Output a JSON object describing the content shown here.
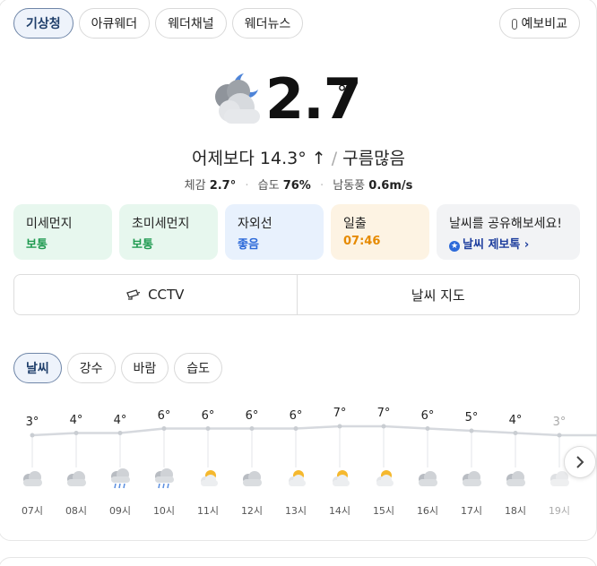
{
  "source_tabs": [
    {
      "label": "기상청",
      "active": true
    },
    {
      "label": "아큐웨더",
      "active": false
    },
    {
      "label": "웨더채널",
      "active": false
    },
    {
      "label": "웨더뉴스",
      "active": false
    }
  ],
  "forecast_compare_label": "예보비교",
  "current": {
    "temp": "2.7",
    "deg": "°",
    "compare": "어제보다 14.3° ↑",
    "condition": "구름많음",
    "feels_label": "체감",
    "feels_value": "2.7°",
    "humidity_label": "습도",
    "humidity_value": "76%",
    "wind_label": "남동풍",
    "wind_value": "0.6m/s"
  },
  "info_cards": [
    {
      "title": "미세먼지",
      "value": "보통"
    },
    {
      "title": "초미세먼지",
      "value": "보통"
    },
    {
      "title": "자외선",
      "value": "좋음"
    },
    {
      "title": "일출",
      "value": "07:46"
    },
    {
      "title": "날씨를 공유해보세요!",
      "value": "날씨 제보톡 ›"
    }
  ],
  "actions": {
    "cctv": "CCTV",
    "map": "날씨 지도"
  },
  "sub_tabs": [
    {
      "label": "날씨",
      "active": true
    },
    {
      "label": "강수",
      "active": false
    },
    {
      "label": "바람",
      "active": false
    },
    {
      "label": "습도",
      "active": false
    }
  ],
  "chart_data": {
    "type": "line",
    "x": [
      "07시",
      "08시",
      "09시",
      "10시",
      "11시",
      "12시",
      "13시",
      "14시",
      "15시",
      "16시",
      "17시",
      "18시",
      "19시"
    ],
    "temps": [
      3,
      4,
      4,
      6,
      6,
      6,
      6,
      7,
      7,
      6,
      5,
      4,
      3
    ],
    "temp_labels": [
      "3°",
      "4°",
      "4°",
      "6°",
      "6°",
      "6°",
      "6°",
      "7°",
      "7°",
      "6°",
      "5°",
      "4°",
      "3°"
    ],
    "icons": [
      "cloudy",
      "cloudy",
      "rain",
      "rain",
      "partly-sunny",
      "cloudy",
      "partly-sunny",
      "partly-sunny",
      "partly-sunny",
      "cloudy",
      "cloudy",
      "cloudy",
      "cloudy"
    ]
  },
  "colors": {
    "line": "#d6d9de",
    "sun": "#f5b82e",
    "cloud": "#c5c9cf",
    "rain": "#5b8fe0"
  }
}
